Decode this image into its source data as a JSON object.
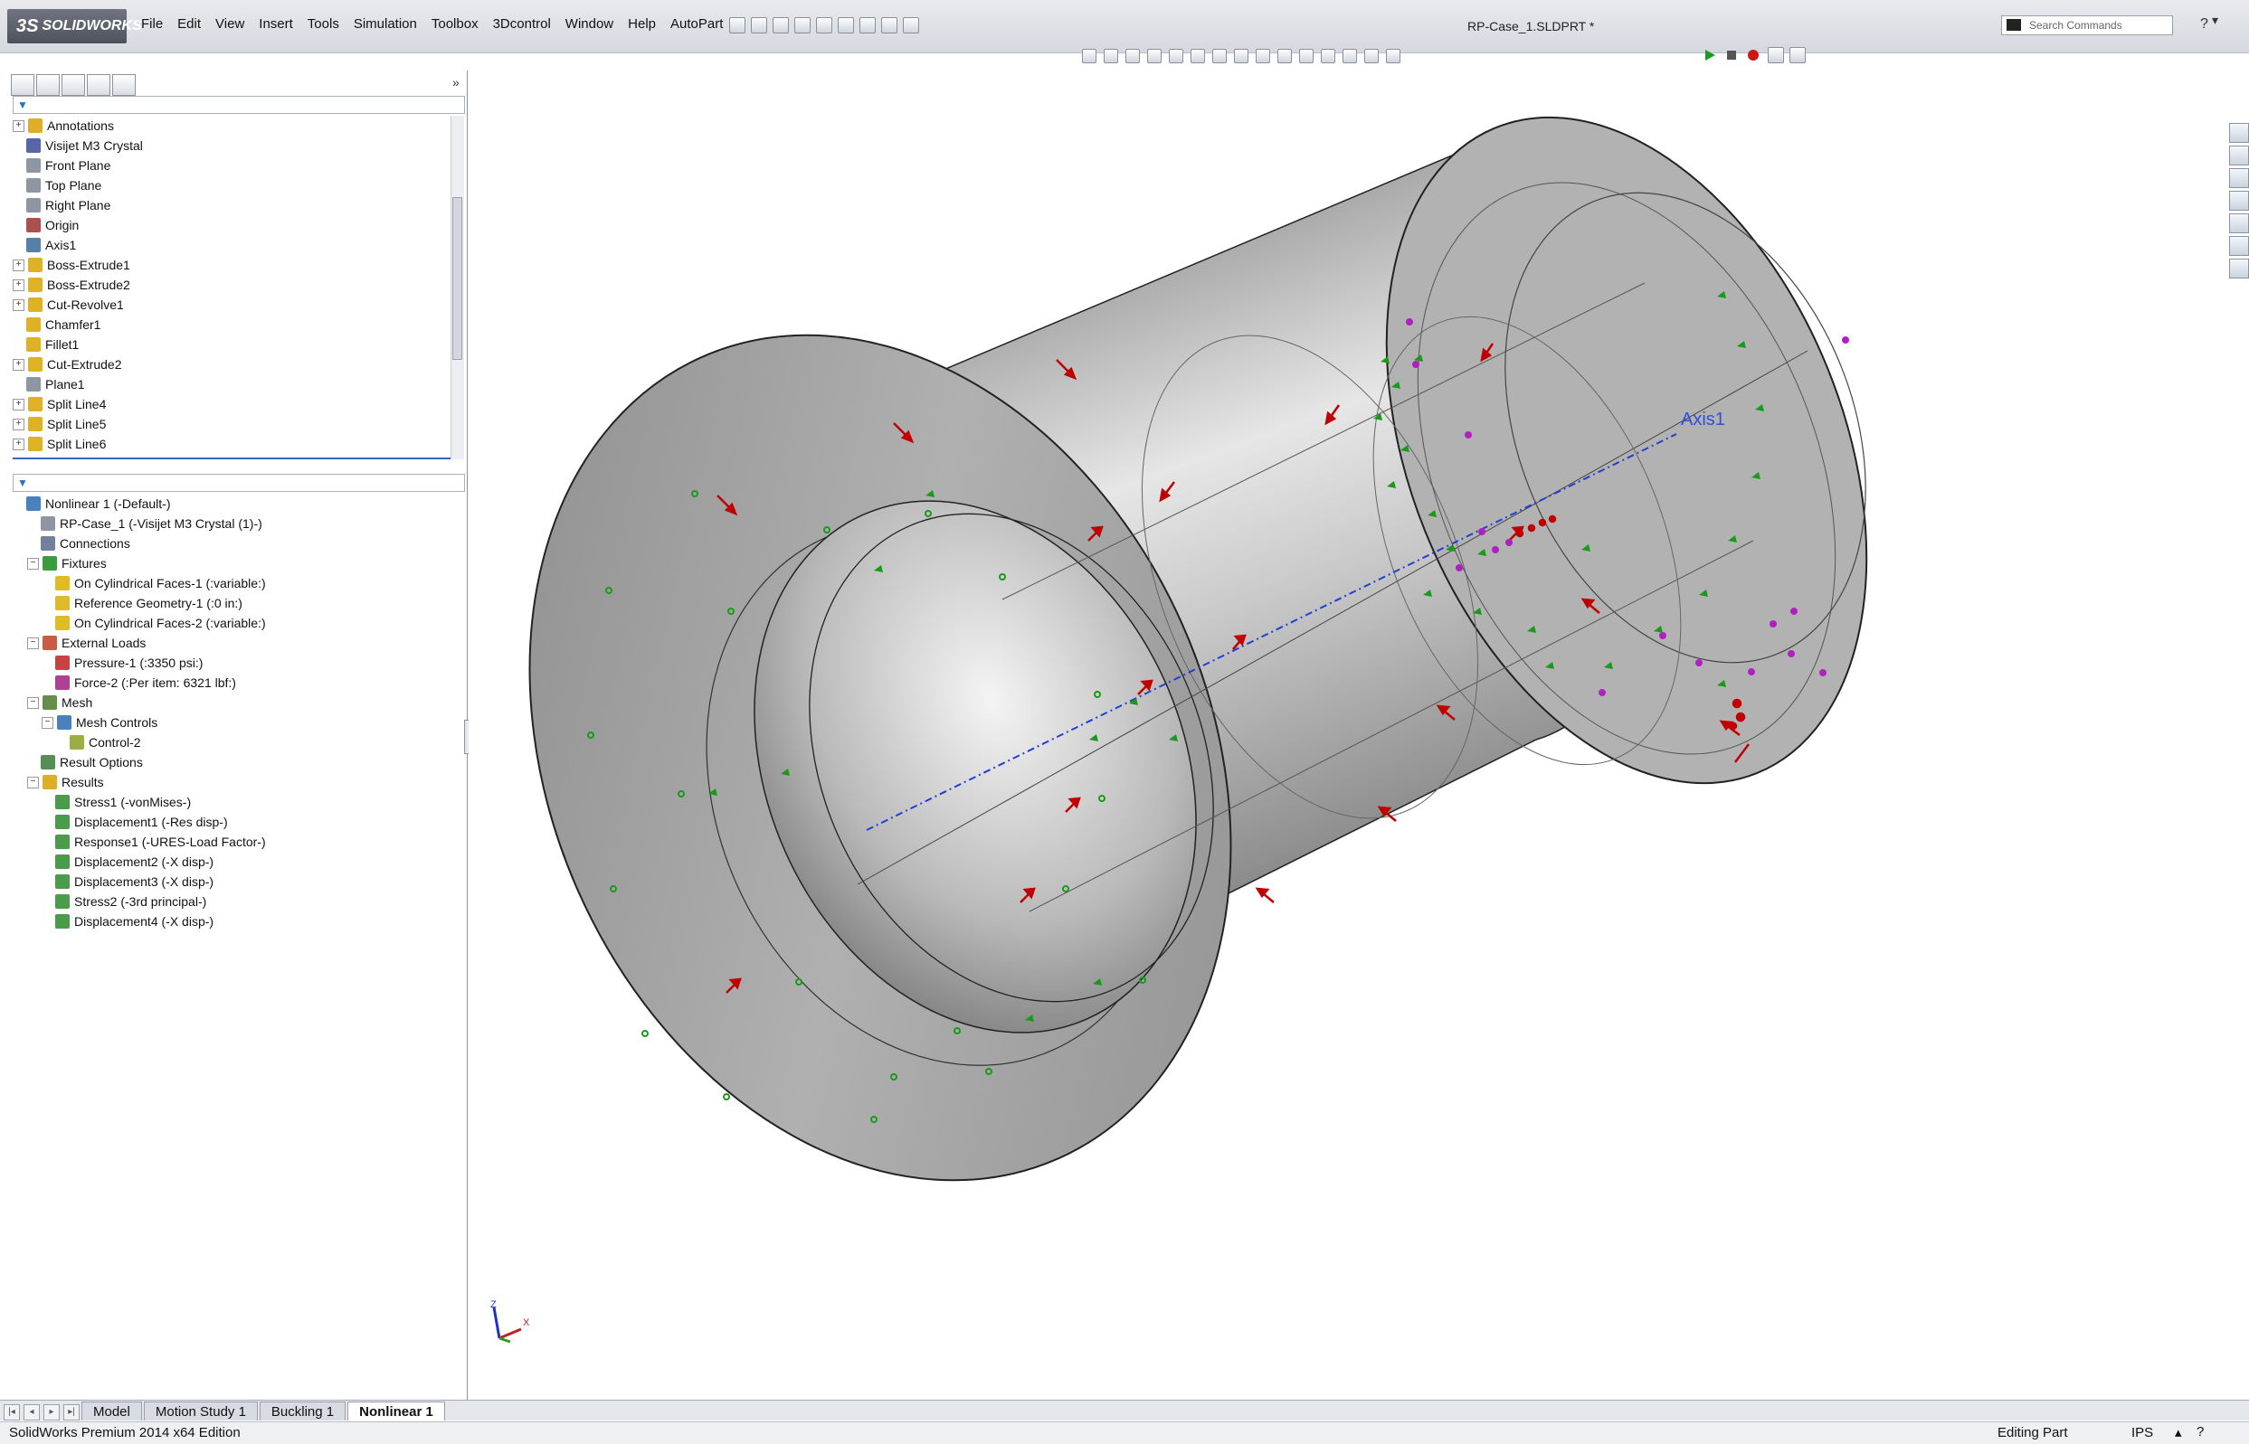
{
  "app": {
    "logo": "SOLIDWORKS",
    "document_title": "RP-Case_1.SLDPRT *"
  },
  "menu": [
    "File",
    "Edit",
    "View",
    "Insert",
    "Tools",
    "Simulation",
    "Toolbox",
    "3Dcontrol",
    "Window",
    "Help",
    "AutoPart"
  ],
  "search": {
    "placeholder": "Search Commands"
  },
  "feature_tree": [
    {
      "label": "Annotations",
      "icon": "annotations-icon",
      "expandable": true
    },
    {
      "label": "Visijet M3 Crystal",
      "icon": "material-icon",
      "expandable": false
    },
    {
      "label": "Front Plane",
      "icon": "plane-icon",
      "expandable": false
    },
    {
      "label": "Top Plane",
      "icon": "plane-icon",
      "expandable": false
    },
    {
      "label": "Right Plane",
      "icon": "plane-icon",
      "expandable": false
    },
    {
      "label": "Origin",
      "icon": "origin-icon",
      "expandable": false
    },
    {
      "label": "Axis1",
      "icon": "axis-icon",
      "expandable": false
    },
    {
      "label": "Boss-Extrude1",
      "icon": "boss-extrude-icon",
      "expandable": true
    },
    {
      "label": "Boss-Extrude2",
      "icon": "boss-extrude-icon",
      "expandable": true
    },
    {
      "label": "Cut-Revolve1",
      "icon": "cut-revolve-icon",
      "expandable": true
    },
    {
      "label": "Chamfer1",
      "icon": "chamfer-icon",
      "expandable": false
    },
    {
      "label": "Fillet1",
      "icon": "fillet-icon",
      "expandable": false
    },
    {
      "label": "Cut-Extrude2",
      "icon": "cut-extrude-icon",
      "expandable": true
    },
    {
      "label": "Plane1",
      "icon": "plane-icon",
      "expandable": false
    },
    {
      "label": "Split Line4",
      "icon": "split-line-icon",
      "expandable": true
    },
    {
      "label": "Split Line5",
      "icon": "split-line-icon",
      "expandable": true
    },
    {
      "label": "Split Line6",
      "icon": "split-line-icon",
      "expandable": true
    }
  ],
  "simulation_tree": [
    {
      "label": "Nonlinear 1 (-Default-)",
      "level": 0,
      "icon": "study-icon",
      "exp": "none"
    },
    {
      "label": "RP-Case_1 (-Visijet M3 Crystal (1)-)",
      "level": 1,
      "icon": "part-icon",
      "exp": "none"
    },
    {
      "label": "Connections",
      "level": 1,
      "icon": "connections-icon",
      "exp": "none"
    },
    {
      "label": "Fixtures",
      "level": 1,
      "icon": "fixtures-icon",
      "exp": "minus"
    },
    {
      "label": "On Cylindrical Faces-1 (:variable:)",
      "level": 2,
      "icon": "fixture-item-icon",
      "exp": "none"
    },
    {
      "label": "Reference Geometry-1 (:0 in:)",
      "level": 2,
      "icon": "fixture-item-icon",
      "exp": "none"
    },
    {
      "label": "On Cylindrical Faces-2 (:variable:)",
      "level": 2,
      "icon": "fixture-item-icon",
      "exp": "none"
    },
    {
      "label": "External Loads",
      "level": 1,
      "icon": "loads-icon",
      "exp": "minus"
    },
    {
      "label": "Pressure-1 (:3350 psi:)",
      "level": 2,
      "icon": "pressure-icon",
      "exp": "none"
    },
    {
      "label": "Force-2 (:Per item: 6321 lbf:)",
      "level": 2,
      "icon": "force-icon",
      "exp": "none"
    },
    {
      "label": "Mesh",
      "level": 1,
      "icon": "mesh-icon",
      "exp": "minus"
    },
    {
      "label": "Mesh Controls",
      "level": 2,
      "icon": "mesh-controls-icon",
      "exp": "minus"
    },
    {
      "label": "Control-2",
      "level": 3,
      "icon": "mesh-control-icon",
      "exp": "none"
    },
    {
      "label": "Result Options",
      "level": 1,
      "icon": "result-options-icon",
      "exp": "none"
    },
    {
      "label": "Results",
      "level": 1,
      "icon": "results-icon",
      "exp": "minus"
    },
    {
      "label": "Stress1 (-vonMises-)",
      "level": 2,
      "icon": "plot-icon",
      "exp": "none"
    },
    {
      "label": "Displacement1 (-Res disp-)",
      "level": 2,
      "icon": "plot-icon",
      "exp": "none"
    },
    {
      "label": "Response1 (-URES-Load Factor-)",
      "level": 2,
      "icon": "plot-icon",
      "exp": "none"
    },
    {
      "label": "Displacement2 (-X disp-)",
      "level": 2,
      "icon": "plot-icon",
      "exp": "none"
    },
    {
      "label": "Displacement3 (-X disp-)",
      "level": 2,
      "icon": "plot-icon",
      "exp": "none"
    },
    {
      "label": "Stress2 (-3rd principal-)",
      "level": 2,
      "icon": "plot-icon",
      "exp": "none"
    },
    {
      "label": "Displacement4 (-X disp-)",
      "level": 2,
      "icon": "plot-icon",
      "exp": "none"
    }
  ],
  "viewport": {
    "axis_label": "Axis1",
    "triad": {
      "z": "Z",
      "x": "X"
    }
  },
  "tabs": [
    {
      "label": "Model",
      "active": false
    },
    {
      "label": "Motion Study 1",
      "active": false
    },
    {
      "label": "Buckling 1",
      "active": false
    },
    {
      "label": "Nonlinear 1",
      "active": true
    }
  ],
  "status": {
    "edition": "SolidWorks Premium 2014 x64 Edition",
    "mode": "Editing Part",
    "units": "IPS"
  },
  "colors": {
    "load_arrow": "#c00000",
    "fixture": "#1a9a1a",
    "mesh_control": "#b020c0",
    "axis": "#2040d0"
  }
}
